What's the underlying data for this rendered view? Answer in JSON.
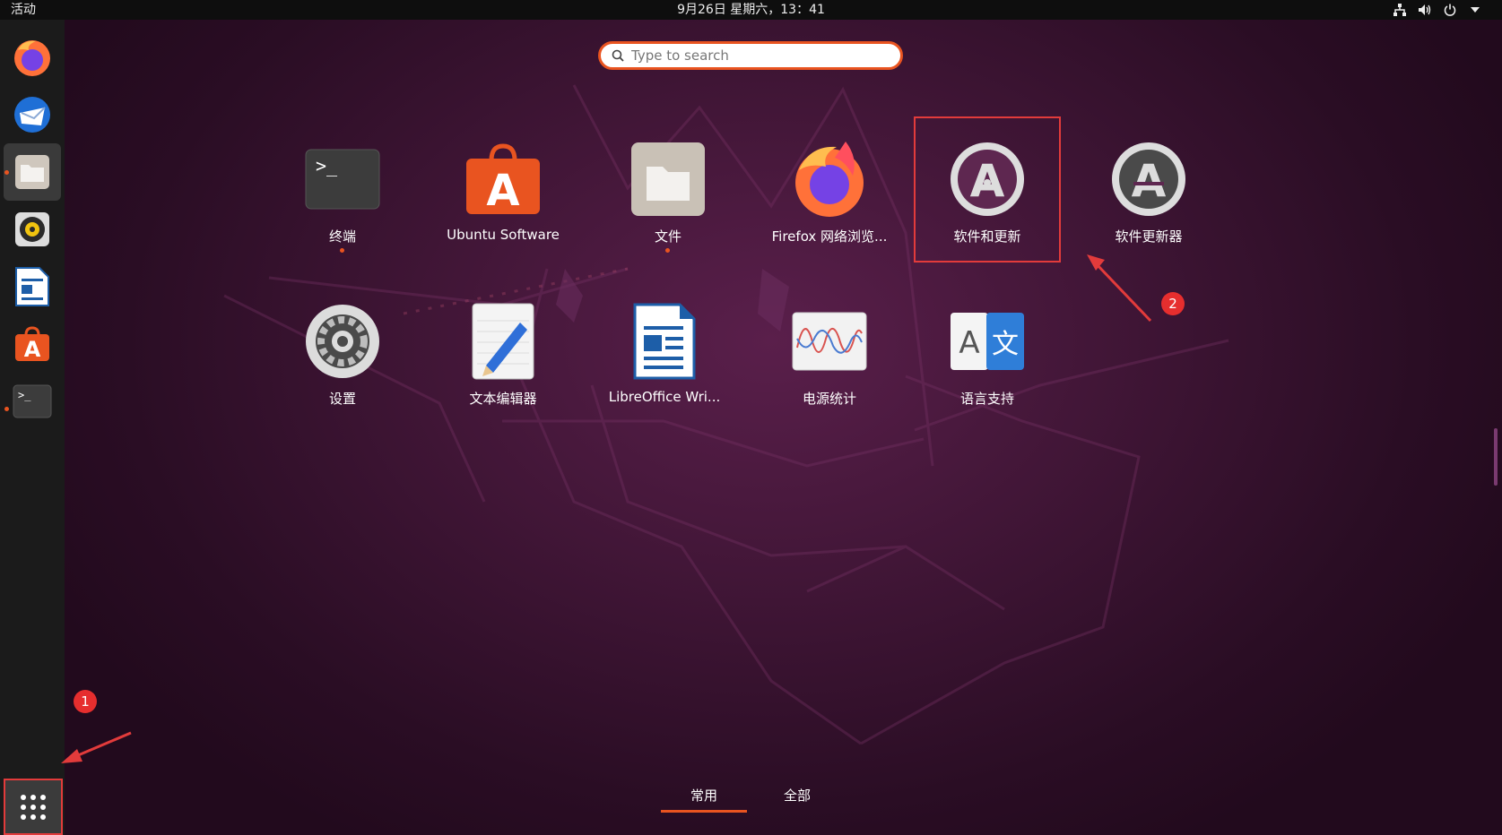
{
  "topbar": {
    "activities": "活动",
    "clock": "9月26日 星期六，13：41"
  },
  "search": {
    "placeholder": "Type to search"
  },
  "apps": [
    {
      "label": "终端",
      "icon": "terminal-icon",
      "running": true
    },
    {
      "label": "Ubuntu Software",
      "icon": "ubuntu-software-icon",
      "running": false
    },
    {
      "label": "文件",
      "icon": "files-icon",
      "running": true
    },
    {
      "label": "Firefox 网络浏览...",
      "icon": "firefox-icon",
      "running": false
    },
    {
      "label": "软件和更新",
      "icon": "software-updates-icon",
      "running": false
    },
    {
      "label": "软件更新器",
      "icon": "software-updater-icon",
      "running": false
    },
    {
      "label": "设置",
      "icon": "settings-gear-icon",
      "running": false
    },
    {
      "label": "文本编辑器",
      "icon": "text-editor-icon",
      "running": false
    },
    {
      "label": "LibreOffice Wri...",
      "icon": "libreoffice-writer-icon",
      "running": false
    },
    {
      "label": "电源统计",
      "icon": "power-statistics-icon",
      "running": false
    },
    {
      "label": "语言支持",
      "icon": "language-support-icon",
      "running": false
    }
  ],
  "badges": {
    "one": "1",
    "two": "2"
  },
  "tabs": {
    "frequent": "常用",
    "all": "全部"
  },
  "colors": {
    "accent": "#e95420",
    "annotation_red": "#e23b3b",
    "topbar": "#0e0e0e",
    "dock": "#1b1b1b"
  }
}
